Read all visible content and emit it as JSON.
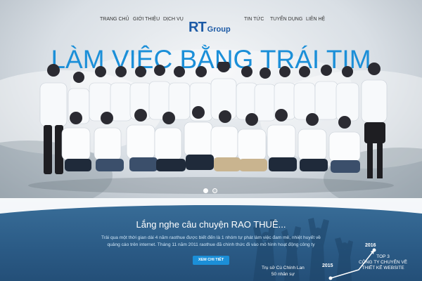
{
  "nav": {
    "items_left": [
      "TRANG CHỦ",
      "GIỚI THIỆU",
      "DỊCH VỤ"
    ],
    "items_right": [
      "TIN TỨC",
      "TUYỂN DỤNG",
      "LIÊN HỆ"
    ],
    "active_index": 0
  },
  "logo": {
    "main": "RT",
    "sub": "Group"
  },
  "hero": {
    "headline": "LÀM VIỆC BẰNG TRÁI TIM",
    "slider": {
      "slide_count": 2,
      "current": 1
    }
  },
  "story": {
    "title": "Lắng nghe câu chuyện RAO THUÊ...",
    "text_line1": "Trải qua một thời gian dài 4 năm raothue được biết đến là 1 nhóm tự phát làm việc đam mê, nhiệt huyết về",
    "text_line2": "quảng cáo trên internet. Tháng 11 năm 2011  raothue đã chính thức đi vào mô hình hoạt động công ty",
    "button_label": "XEM CHI TIẾT"
  },
  "timeline": {
    "year_2015": "2015",
    "year_2016": "2016",
    "milestone_2015_line1": "Trụ sở Cù Chính Lan",
    "milestone_2015_line2": "50 nhân sự",
    "milestone_2016_line1": "TOP 3",
    "milestone_2016_line2": "CÔNG TY CHUYÊN VỀ",
    "milestone_2016_line3": "THIẾT KẾ WEBSITE"
  },
  "colors": {
    "accent": "#1b8fd8",
    "logo": "#1c5aa6",
    "story_bg": "#2b5b86"
  }
}
